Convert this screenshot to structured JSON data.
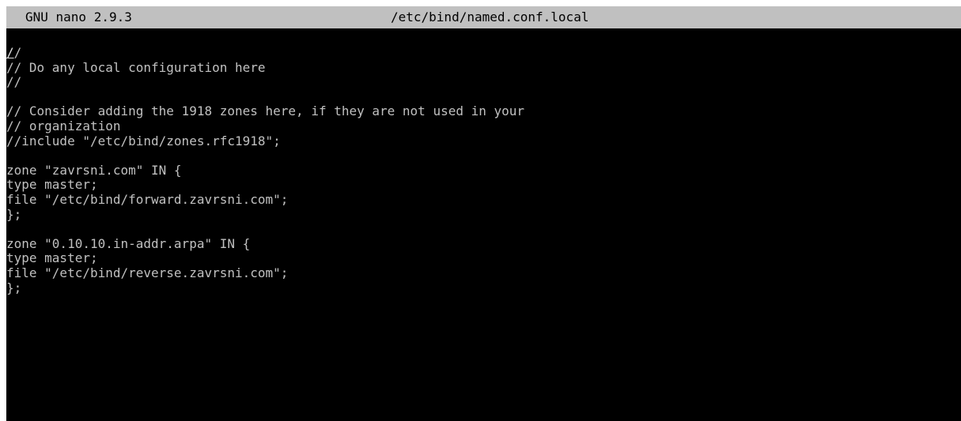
{
  "window": {
    "app_version": "GNU nano 2.9.3",
    "filename": "/etc/bind/named.conf.local"
  },
  "editor": {
    "cursor_char": "/",
    "first_line_rest": "/",
    "lines": [
      "//",
      "// Do any local configuration here",
      "//",
      "",
      "// Consider adding the 1918 zones here, if they are not used in your",
      "// organization",
      "//include \"/etc/bind/zones.rfc1918\";",
      "",
      "zone \"zavrsni.com\" IN {",
      "type master;",
      "file \"/etc/bind/forward.zavrsni.com\";",
      "};",
      "",
      "zone \"0.10.10.in-addr.arpa\" IN {",
      "type master;",
      "file \"/etc/bind/reverse.zavrsni.com\";",
      "};"
    ]
  },
  "colors": {
    "background": "#000000",
    "foreground": "#c0c0c0",
    "titlebar_bg": "#c0c0c0",
    "titlebar_fg": "#000000"
  }
}
